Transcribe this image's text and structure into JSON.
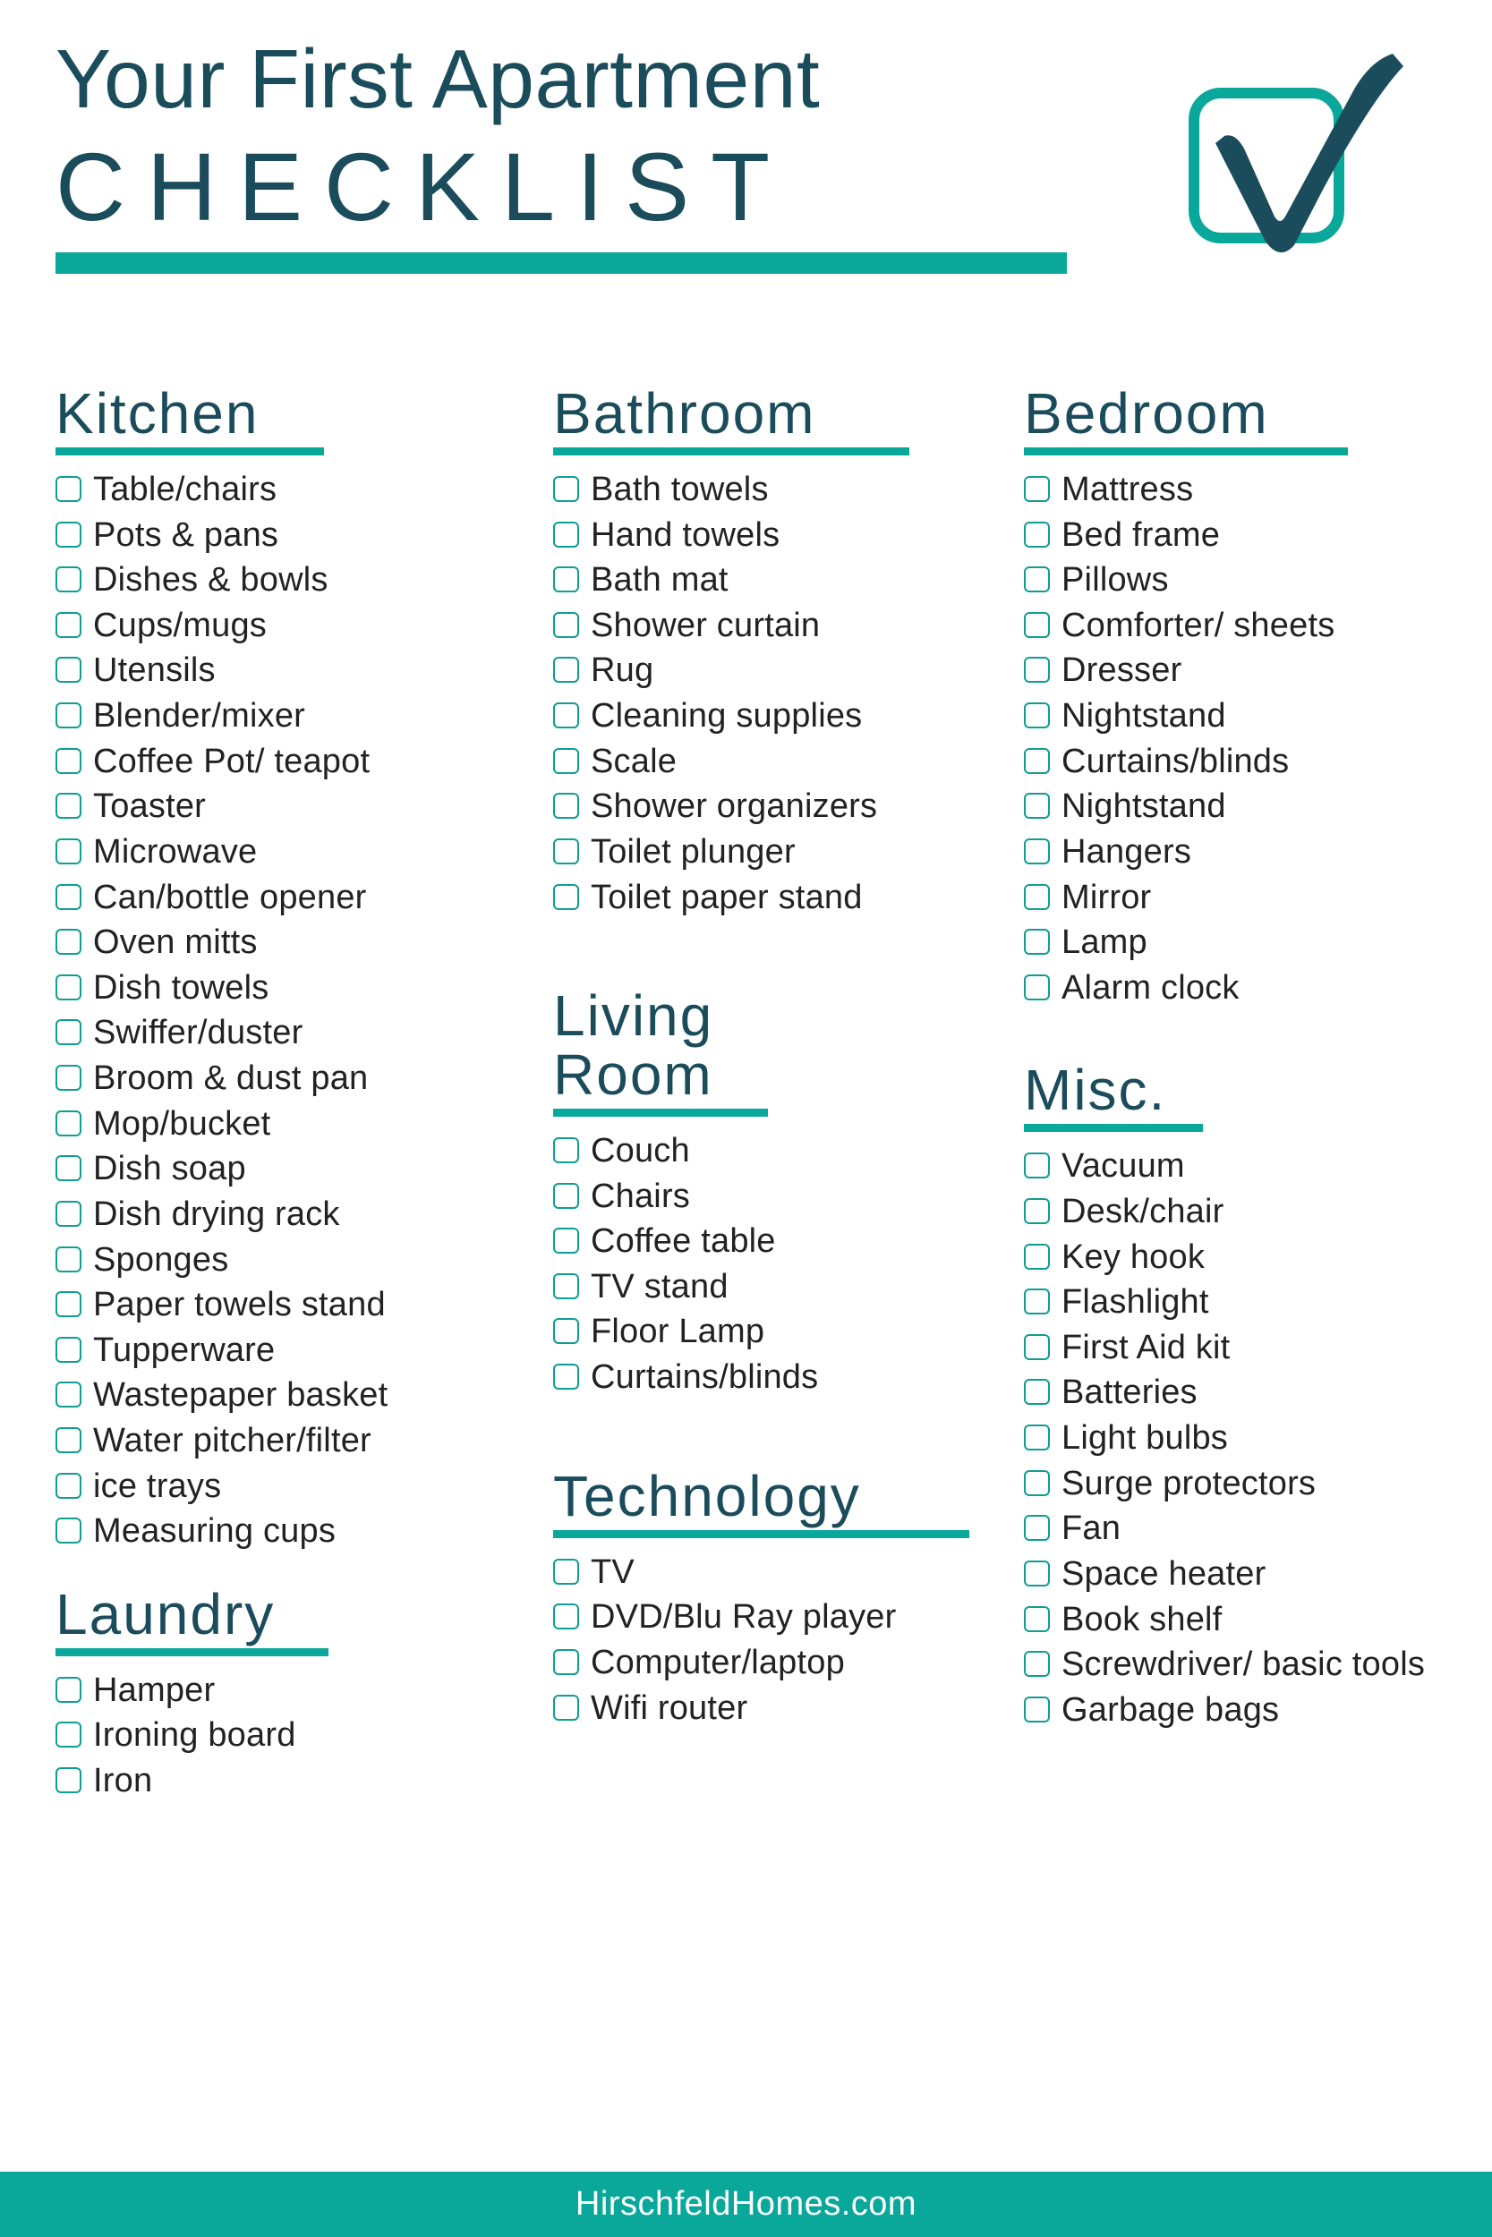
{
  "colors": {
    "dark_teal": "#1b4c5b",
    "bright_teal": "#0aa79b",
    "checkbox_border": "#0f9e92",
    "text": "#222222",
    "background": "#ffffff"
  },
  "header": {
    "title_line1": "Your First Apartment",
    "title_line2": "CHECKLIST",
    "logo_icon": "checkmark-in-box-icon"
  },
  "columns": [
    {
      "id": "left",
      "sections": [
        {
          "id": "kitchen",
          "title": "Kitchen",
          "items": [
            "Table/chairs",
            "Pots & pans",
            "Dishes & bowls",
            "Cups/mugs",
            "Utensils",
            "Blender/mixer",
            "Coffee Pot/ teapot",
            "Toaster",
            "Microwave",
            "Can/bottle opener",
            "Oven mitts",
            "Dish towels",
            "Swiffer/duster",
            "Broom & dust pan",
            "Mop/bucket",
            "Dish soap",
            "Dish drying rack",
            "Sponges",
            "Paper towels stand",
            "Tupperware",
            "Wastepaper basket",
            "Water pitcher/filter",
            "ice trays",
            "Measuring cups"
          ]
        },
        {
          "id": "laundry",
          "title": "Laundry",
          "items": [
            "Hamper",
            "Ironing board",
            "Iron"
          ]
        }
      ]
    },
    {
      "id": "middle",
      "sections": [
        {
          "id": "bathroom",
          "title": "Bathroom",
          "items": [
            "Bath towels",
            "Hand towels",
            "Bath mat",
            "Shower curtain",
            "Rug",
            "Cleaning supplies",
            "Scale",
            "Shower organizers",
            "Toilet plunger",
            "Toilet paper stand"
          ]
        },
        {
          "id": "living-room",
          "title": "Living\nRoom",
          "items": [
            "Couch",
            "Chairs",
            "Coffee table",
            "TV stand",
            "Floor Lamp",
            "Curtains/blinds"
          ]
        },
        {
          "id": "technology",
          "title": "Technology",
          "items": [
            "TV",
            "DVD/Blu Ray player",
            "Computer/laptop",
            "Wifi router"
          ]
        }
      ]
    },
    {
      "id": "right",
      "sections": [
        {
          "id": "bedroom",
          "title": "Bedroom",
          "items": [
            "Mattress",
            "Bed frame",
            "Pillows",
            "Comforter/ sheets",
            "Dresser",
            "Nightstand",
            "Curtains/blinds",
            "Nightstand",
            "Hangers",
            "Mirror",
            "Lamp",
            "Alarm clock"
          ]
        },
        {
          "id": "misc",
          "title": "Misc.",
          "items": [
            "Vacuum",
            "Desk/chair",
            "Key hook",
            "Flashlight",
            "First Aid kit",
            "Batteries",
            "Light bulbs",
            "Surge protectors",
            "Fan",
            "Space heater",
            "Book shelf",
            "Screwdriver/ basic tools",
            "Garbage bags"
          ]
        }
      ]
    }
  ],
  "footer": {
    "website": "HirschfeldHomes.com"
  }
}
